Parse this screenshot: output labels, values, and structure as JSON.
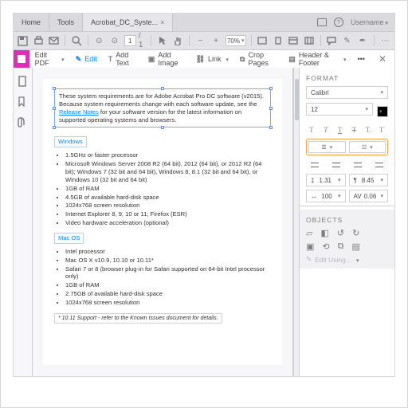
{
  "tabs": {
    "home": "Home",
    "tools": "Tools",
    "doc": "Acrobat_DC_Syste...",
    "username": "Username"
  },
  "toolbar": {
    "page_current": "1",
    "page_total": "/ 1",
    "zoom": "70%"
  },
  "editbar": {
    "title": "Edit PDF",
    "edit": "Edit",
    "add_text": "Add Text",
    "add_image": "Add Image",
    "link": "Link",
    "crop": "Crop Pages",
    "header": "Header & Footer",
    "more": "•••"
  },
  "doc": {
    "intro_a": "These system requirements are for Adobe Acrobat Pro DC ",
    "intro_b": "oftware (v2015). Because system requirements change with each software update, see the ",
    "intro_link": "Release Notes",
    "intro_c": " for your software version for the latest information on supported operating systems and browsers.",
    "cursor": "ṣ",
    "win_h": "Windows",
    "win": [
      "1.5GHz or faster processor",
      "Microsoft Windows Server 2008 R2 (64 bit), 2012 (64 bit), or 2012 R2 (64 bit); Windows 7 (32 bit and 64 bit), Windows 8, 8.1 (32 bit and 64 bit), or Windows 10 (32 bit and 64 bit)",
      "1GB of RAM",
      "4.5GB of available hard-disk space",
      "1024x768 screen resolution",
      "Internet Explorer 8, 9, 10 or 11; Firefox (ESR)",
      "Video hardware acceleration (optional)"
    ],
    "mac_h": "Mac OS",
    "mac": [
      "Intel processor",
      "Mac OS X v10.9, 10.10 or 10.11*",
      "Safari 7 or 8 (browser plug-in for Safari supported on 64-bit Intel processor only)",
      "1GB of RAM",
      "2.75GB of available hard-disk space",
      "1024x768 screen resolution"
    ],
    "foot": "* 10.11 Support - refer to the Known Issues document for details."
  },
  "format": {
    "title": "FORMAT",
    "font": "Calibri",
    "size": "12",
    "line_h": "1.31",
    "para_sp": "8.45",
    "hscale": "100",
    "av": "0.06",
    "objects": "OBJECTS",
    "edit_using": "Edit Using..."
  }
}
